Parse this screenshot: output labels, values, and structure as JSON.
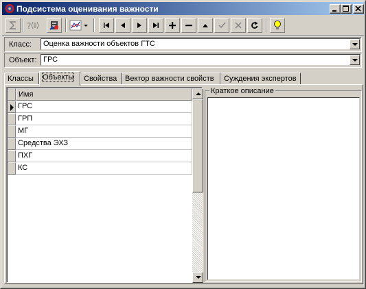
{
  "window": {
    "title": "Подсистема оценивания важности",
    "icon": "app-icon",
    "controls": [
      "minimize",
      "maximize",
      "close"
    ]
  },
  "toolbar": {
    "buttons": [
      {
        "icon": "sum-icon",
        "enabled": false
      },
      {
        "icon": "expert-query-icon",
        "enabled": false
      },
      {
        "icon": "tools-icon",
        "enabled": true
      },
      {
        "icon": "chart-dropdown-icon",
        "enabled": true
      },
      {
        "icon": "nav-first-icon",
        "enabled": true
      },
      {
        "icon": "nav-prior-icon",
        "enabled": true
      },
      {
        "icon": "nav-next-icon",
        "enabled": true
      },
      {
        "icon": "nav-last-icon",
        "enabled": true
      },
      {
        "icon": "nav-insert-icon",
        "enabled": true
      },
      {
        "icon": "nav-delete-icon",
        "enabled": true
      },
      {
        "icon": "nav-edit-icon",
        "enabled": true
      },
      {
        "icon": "nav-post-icon",
        "enabled": false
      },
      {
        "icon": "nav-cancel-icon",
        "enabled": false
      },
      {
        "icon": "nav-refresh-icon",
        "enabled": true
      },
      {
        "icon": "lightbulb-icon",
        "enabled": true
      }
    ]
  },
  "class_selector": {
    "label": "Класс:",
    "value": "Оценка важности объектов ГТС"
  },
  "object_selector": {
    "label": "Объект:",
    "value": "ГРС"
  },
  "tabs": [
    {
      "label": "Классы",
      "active": false
    },
    {
      "label": "Объекты",
      "active": true
    },
    {
      "label": "Свойства",
      "active": false
    },
    {
      "label": "Вектор важности свойств",
      "active": false
    },
    {
      "label": "Суждения экспертов",
      "active": false
    }
  ],
  "grid": {
    "column_header": "Имя",
    "rows": [
      "ГРС",
      "ГРП",
      "МГ",
      "Средства ЭХЗ",
      "ПХГ",
      "КС"
    ],
    "current_row": 0
  },
  "description": {
    "legend": "Краткое описание",
    "text": ""
  },
  "colors": {
    "titlebar_start": "#0a246a",
    "titlebar_end": "#a6caf0",
    "face": "#d4d0c8"
  }
}
